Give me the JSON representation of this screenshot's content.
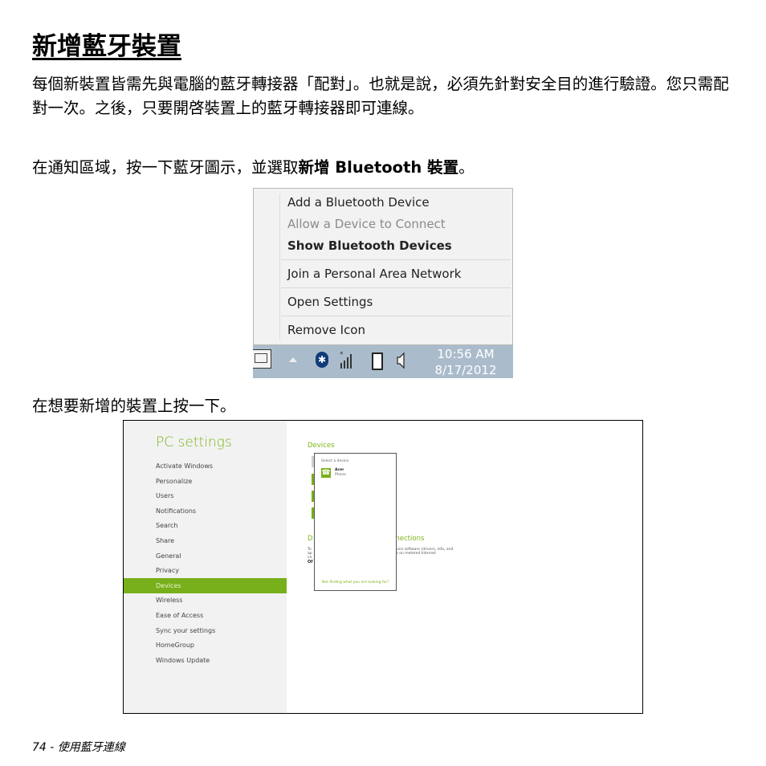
{
  "document": {
    "title": "新增藍牙裝置",
    "paragraph1": "每個新裝置皆需先與電腦的藍牙轉接器「配對」。也就是說，必須先針對安全目的進行驗證。您只需配對一次。之後，只要開啓裝置上的藍牙轉接器即可連線。",
    "paragraph2_prefix": "在通知區域，按一下藍牙圖示，並選取",
    "paragraph2_bold": "新增 Bluetooth 裝置",
    "paragraph2_suffix": "。",
    "paragraph3": "在想要新增的裝置上按一下。",
    "footer": "74 - 使用藍牙連線"
  },
  "context_menu": {
    "items": [
      {
        "label": "Add a Bluetooth Device",
        "state": "normal"
      },
      {
        "label": "Allow a Device to Connect",
        "state": "disabled"
      },
      {
        "label": "Show Bluetooth Devices",
        "state": "default"
      },
      {
        "label": "Join a Personal Area Network",
        "state": "normal"
      },
      {
        "label": "Open Settings",
        "state": "normal"
      },
      {
        "label": "Remove Icon",
        "state": "normal"
      }
    ]
  },
  "taskbar": {
    "time": "10:56 AM",
    "date": "8/17/2012",
    "icons": [
      "keyboard-icon",
      "show-hidden-icons-arrow",
      "bluetooth-icon",
      "signal-icon",
      "battery-icon",
      "speaker-icon"
    ]
  },
  "pc_settings": {
    "title": "PC settings",
    "nav": [
      "Activate Windows",
      "Personalize",
      "Users",
      "Notifications",
      "Search",
      "Share",
      "General",
      "Privacy",
      "Devices",
      "Wireless",
      "Ease of Access",
      "Sync your settings",
      "HomeGroup",
      "Windows Update"
    ],
    "active_nav": "Devices",
    "main_heading": "Devices",
    "section_heading_fragment_left": "D",
    "section_heading_fragment_right": "nnections",
    "body_fragment_1": "To",
    "body_fragment_2": "ap",
    "body_fragment_3": "co",
    "body_fragment_4": "Of",
    "body_right_1": "vice software (drivers, info, and",
    "body_right_2": "e on metered Internet",
    "popup": {
      "heading": "Select a device",
      "device_name": "Acer",
      "device_type": "Phone",
      "link": "Not finding what you are looking for?"
    }
  },
  "colors": {
    "accent_green": "#78b01b",
    "taskbar": "#aabccb",
    "bluetooth_badge": "#0f3b78"
  }
}
